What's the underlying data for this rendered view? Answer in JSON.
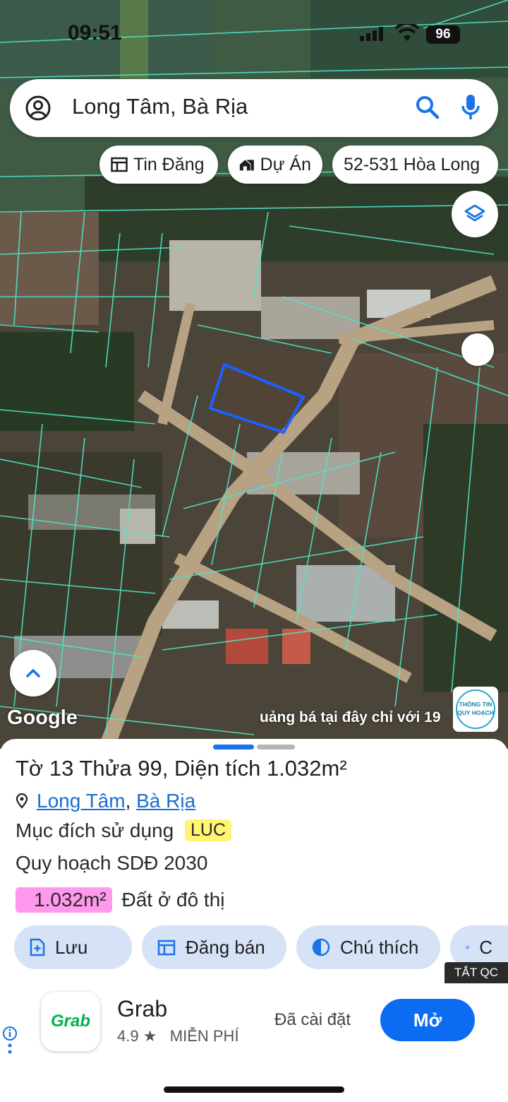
{
  "status_bar": {
    "time": "09:51",
    "battery": "96"
  },
  "search": {
    "query": "Long Tâm, Bà Rịa"
  },
  "filter_chips": [
    {
      "label": "Tin Đăng",
      "icon": "listing-icon"
    },
    {
      "label": "Dự Án",
      "icon": "house-icon"
    },
    {
      "label": "52-531 Hòa Long",
      "icon": ""
    }
  ],
  "map": {
    "attribution": "Google",
    "banner_text": "uảng bá tại đây chỉ với 19",
    "badge_text": "THÔNG TIN QUY HOẠCH",
    "parcel_outline_color": "#1e5fff",
    "parcel_line_color": "#4ee6c8"
  },
  "sheet": {
    "title_prefix": "Tờ",
    "sheet_no": "13",
    "parcel_label": "Thửa",
    "parcel_no": "99",
    "area_label": "Diện tích",
    "area_value": "1.032m²",
    "location_1": "Long Tâm",
    "location_sep": ",",
    "location_2": "Bà Rịa",
    "usage_label": "Mục đích sử dụng",
    "usage_code": "LUC",
    "usage_code_color": "#fff573",
    "plan_label": "Quy hoạch SDĐ 2030",
    "plan_area": "1.032m²",
    "plan_area_color": "#ff99ee",
    "plan_type": "Đất ở đô thị"
  },
  "actions": [
    {
      "label": "Lưu",
      "icon": "add-file-icon"
    },
    {
      "label": "Đăng bán",
      "icon": "post-icon"
    },
    {
      "label": "Chú thích",
      "icon": "contrast-icon"
    },
    {
      "label": "C",
      "icon": "camera-icon"
    }
  ],
  "ad": {
    "close_label": "TẮT QC",
    "app_logo": "Grab",
    "app_name": "Grab",
    "rating": "4.9 ★",
    "price": "MIỄN PHÍ",
    "installed": "Đã cài đặt",
    "open_label": "Mở",
    "accent": "#0b6cf2"
  }
}
